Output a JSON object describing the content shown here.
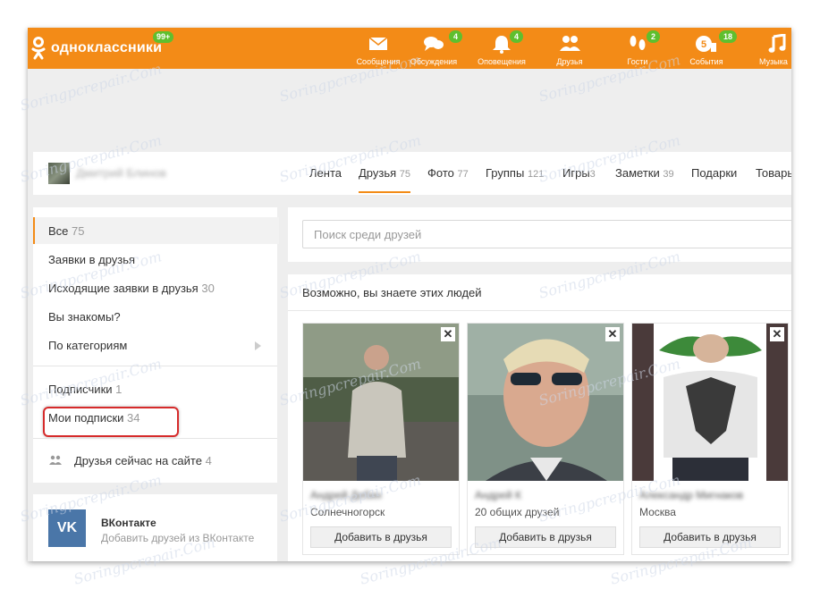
{
  "header": {
    "brand": "одноклассники",
    "brand_badge": "99+",
    "nav": [
      {
        "label": "Сообщения",
        "icon": "envelope-icon",
        "badge": ""
      },
      {
        "label": "Обсуждения",
        "icon": "chat-bubbles-icon",
        "badge": "4"
      },
      {
        "label": "Оповещения",
        "icon": "bell-icon",
        "badge": "4"
      },
      {
        "label": "Друзья",
        "icon": "friends-icon",
        "badge": ""
      },
      {
        "label": "Гости",
        "icon": "footprints-icon",
        "badge": "2"
      },
      {
        "label": "События",
        "icon": "events-icon",
        "badge": "18"
      },
      {
        "label": "Музыка",
        "icon": "music-note-icon",
        "badge": ""
      }
    ]
  },
  "profile": {
    "name": "Дмитрий Блинов",
    "tabs": [
      {
        "label": "Лента",
        "count": ""
      },
      {
        "label": "Друзья",
        "count": "75"
      },
      {
        "label": "Фото",
        "count": "77"
      },
      {
        "label": "Группы",
        "count": "121"
      },
      {
        "label": "Игры",
        "count": "3"
      },
      {
        "label": "Заметки",
        "count": "39"
      },
      {
        "label": "Подарки",
        "count": ""
      },
      {
        "label": "Товары",
        "count": ""
      }
    ]
  },
  "sidebar": {
    "items": [
      {
        "label": "Все",
        "count": "75"
      },
      {
        "label": "Заявки в друзья",
        "count": ""
      },
      {
        "label": "Исходящие заявки в друзья",
        "count": "30"
      },
      {
        "label": "Вы знакомы?",
        "count": ""
      },
      {
        "label": "По категориям",
        "count": ""
      },
      {
        "label": "Подписчики",
        "count": "1"
      },
      {
        "label": "Мои подписки",
        "count": "34"
      },
      {
        "label": "Друзья сейчас на сайте",
        "count": "4"
      }
    ]
  },
  "vk": {
    "logo": "VK",
    "title": "ВКонтакте",
    "subtitle": "Добавить друзей из ВКонтакте"
  },
  "search": {
    "placeholder": "Поиск среди друзей"
  },
  "suggestions": {
    "title": "Возможно, вы знаете этих людей",
    "close_label": "✕",
    "cards": [
      {
        "name": "Андрей Дебин",
        "info": "Солнечногорск",
        "button": "Добавить в друзья"
      },
      {
        "name": "Андрей К",
        "info": "20 общих друзей",
        "button": "Добавить в друзья"
      },
      {
        "name": "Александр Мигнаков",
        "info": "Москва",
        "button": "Добавить в друзья"
      }
    ]
  },
  "watermark": "Soringpcrepair.Com",
  "colors": {
    "brand_orange": "#f38b17",
    "badge_green": "#5fbf2e",
    "highlight_red": "#d62b2b",
    "vk_blue": "#4a76a8"
  }
}
